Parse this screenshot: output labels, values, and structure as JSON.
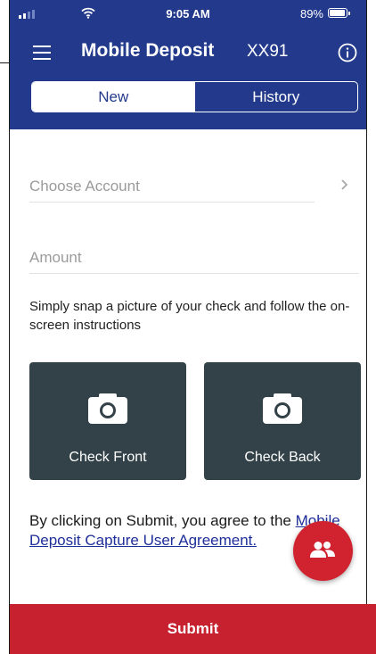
{
  "status_bar": {
    "time": "9:05 AM",
    "battery_percent": "89%",
    "battery_level": 0.89,
    "icons": [
      "signal-icon",
      "wifi-icon",
      "battery-icon"
    ]
  },
  "header": {
    "menu_icon": "menu-icon",
    "title": "Mobile Deposit",
    "account_suffix": "XX91",
    "info_icon": "info-icon",
    "background_color": "#233a8c"
  },
  "tabs": [
    {
      "label": "New",
      "selected": true
    },
    {
      "label": "History",
      "selected": false
    }
  ],
  "form": {
    "account_placeholder": "Choose Account",
    "amount_placeholder": "Amount",
    "instructions": "Simply snap a picture of your check and follow the on-screen instructions"
  },
  "capture": {
    "front_label": "Check Front",
    "back_label": "Check Back",
    "icon": "camera-icon",
    "tile_color": "#334248"
  },
  "agreement": {
    "prefix": "By clicking on Submit, you agree to the ",
    "link_text": "Mobile Deposit Capture User Agreement."
  },
  "fab": {
    "icon": "people-icon",
    "color": "#d1232f"
  },
  "submit": {
    "label": "Submit",
    "color": "#c7202e"
  }
}
